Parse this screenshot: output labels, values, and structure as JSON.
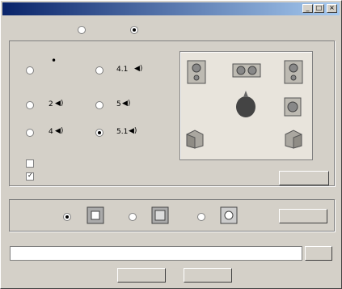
{
  "window": {
    "title": "",
    "min_glyph": "_",
    "max_glyph": "□",
    "close_glyph": "×"
  },
  "prefs": {
    "label": "",
    "opt1": "",
    "opt2": ""
  },
  "speakers": {
    "group_label": "",
    "options": [
      {
        "label": ""
      },
      {
        "label": "4.1"
      },
      {
        "label": "2"
      },
      {
        "label": "5"
      },
      {
        "label": "4"
      },
      {
        "label": "5.1"
      }
    ],
    "check1_label": "",
    "check2_label": "",
    "test_button": ""
  },
  "env": {
    "group_label": "",
    "settings_button": ""
  },
  "path": {
    "label": "",
    "value": "",
    "browse_button": ""
  },
  "footer": {
    "ok_button": "",
    "cancel_button": ""
  }
}
